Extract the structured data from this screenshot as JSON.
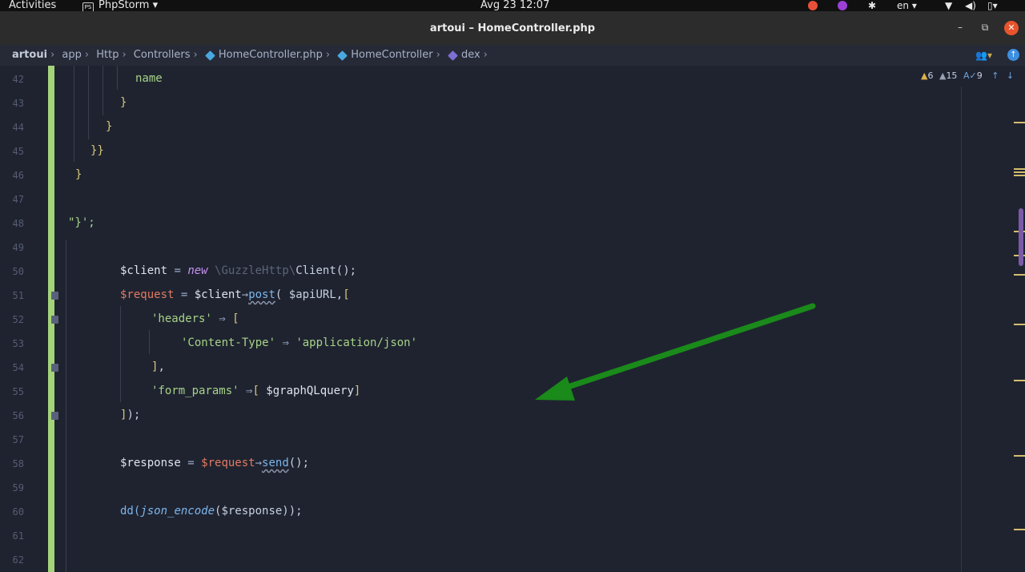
{
  "topbar": {
    "activities": "Activities",
    "app_name": "PhpStorm",
    "clock": "Avg 23  12:07",
    "language": "en"
  },
  "window": {
    "title": "artoui – HomeController.php"
  },
  "breadcrumb": {
    "items": [
      "artoui",
      "app",
      "Http",
      "Controllers",
      "HomeController.php",
      "HomeController",
      "dex"
    ]
  },
  "inspections": {
    "warnings": "6",
    "weak_warnings": "15",
    "typos": "9"
  },
  "editor": {
    "line_numbers": [
      "42",
      "43",
      "44",
      "45",
      "46",
      "47",
      "48",
      "49",
      "50",
      "51",
      "52",
      "53",
      "54",
      "55",
      "56",
      "57",
      "58",
      "59",
      "60",
      "61",
      "62"
    ],
    "lines": {
      "l42": {
        "t1": "name"
      },
      "l43": {
        "t1": "}"
      },
      "l44": {
        "t1": "}"
      },
      "l45": {
        "t1": "}}"
      },
      "l46": {
        "t1": "}"
      },
      "l48": {
        "t1": "\"}';"
      },
      "l50": {
        "t1": "$client",
        "t2": " = ",
        "t3": "new",
        "t4": " \\GuzzleHttp\\",
        "t5": "Client();"
      },
      "l51": {
        "t1": "$request",
        "t2": " = ",
        "t3": "$client",
        "t4": "→",
        "t5": "post",
        "t6": "( $apiURL,",
        "t7": "["
      },
      "l52": {
        "t1": "'headers'",
        "t2": " ⇒ ",
        "t3": "["
      },
      "l53": {
        "t1": "'Content-Type'",
        "t2": " ⇒ ",
        "t3": "'application/json'"
      },
      "l54": {
        "t1": "]",
        "t2": ","
      },
      "l55": {
        "t1": "'form_params'",
        "t2": " ⇒",
        "t3": "[",
        "t4": " $graphQLquery",
        "t5": "]"
      },
      "l56": {
        "t1": "]",
        "t2": ");"
      },
      "l58": {
        "t1": "$response",
        "t2": " = ",
        "t3": "$request",
        "t4": "→",
        "t5": "send",
        "t6": "();"
      },
      "l60": {
        "t1": "dd(",
        "t2": "json_encode",
        "t3": "($response));"
      }
    }
  },
  "colors": {
    "editor_bg": "#1f2330",
    "change_bar": "#a4d37a",
    "arrow": "#1a8a1a",
    "variable_red": "#e07b61",
    "string_green": "#a6d387",
    "keyword_purple": "#c592f2"
  },
  "icons": [
    "app-menu-icon",
    "chrome-icon",
    "firefox-icon",
    "slack-icon",
    "wifi-icon",
    "volume-icon",
    "battery-icon",
    "minimize-icon",
    "maximize-icon",
    "close-icon",
    "class-icon",
    "user-icon",
    "update-icon",
    "warning-icon",
    "weak-warning-icon",
    "typo-icon",
    "arrow-up-icon",
    "arrow-down-icon",
    "green-arrow-annotation"
  ]
}
